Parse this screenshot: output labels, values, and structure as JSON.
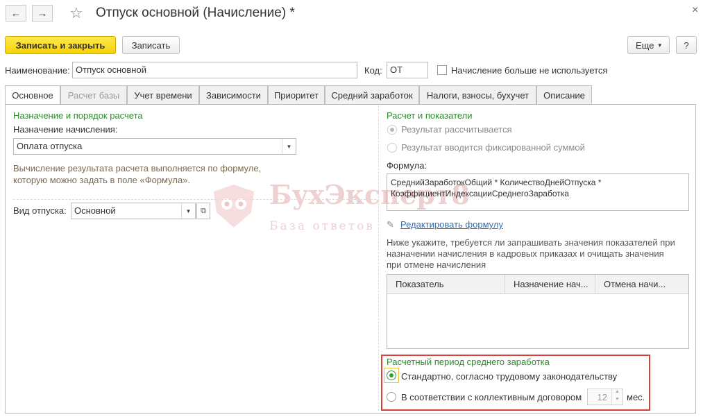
{
  "window": {
    "title": "Отпуск основной (Начисление) *",
    "back_icon": "←",
    "forward_icon": "→",
    "star_icon": "☆",
    "close_icon": "×"
  },
  "toolbar": {
    "save_close_label": "Записать и закрыть",
    "save_label": "Записать",
    "more_label": "Еще",
    "more_arrow": "▾",
    "help_label": "?"
  },
  "header": {
    "name_label": "Наименование:",
    "name_value": "Отпуск основной",
    "code_label": "Код:",
    "code_value": "ОТ",
    "unused_label": "Начисление больше не используется"
  },
  "tabs": [
    {
      "label": "Основное"
    },
    {
      "label": "Расчет базы"
    },
    {
      "label": "Учет времени"
    },
    {
      "label": "Зависимости"
    },
    {
      "label": "Приоритет"
    },
    {
      "label": "Средний заработок"
    },
    {
      "label": "Налоги, взносы, бухучет"
    },
    {
      "label": "Описание"
    }
  ],
  "left": {
    "section_title": "Назначение и порядок расчета",
    "purpose_label": "Назначение начисления:",
    "purpose_value": "Оплата отпуска",
    "hint": "Вычисление результата расчета выполняется по формуле, которую можно задать в поле «Формула».",
    "vacation_label": "Вид отпуска:",
    "vacation_value": "Основной"
  },
  "right": {
    "section_title": "Расчет и показатели",
    "radio_calc": "Результат рассчитывается",
    "radio_fixed": "Результат вводится фиксированной суммой",
    "formula_label": "Формула:",
    "formula_value": "СреднийЗаработокОбщий * КоличествоДнейОтпуска * КоэффициентИндексацииСреднегоЗаработка",
    "edit_formula_link": "Редактировать формулу",
    "indicators_hint": "Ниже укажите, требуется ли запрашивать значения показателей при назначении начисления в кадровых приказах и очищать значения при отмене начисления",
    "grid_headers": [
      "Показатель",
      "Назначение нач...",
      "Отмена начи..."
    ]
  },
  "avg_period": {
    "title": "Расчетный период среднего заработка",
    "option_standard": "Стандартно, согласно трудовому законодательству",
    "option_collective": "В соответствии с коллективным договором",
    "months_value": "12",
    "months_unit": "мес."
  },
  "watermark": {
    "brand": "БухЭксперт8",
    "tagline": "База ответов"
  },
  "colors": {
    "accent_yellow": "#f5d20a",
    "section_green": "#2e8b2e",
    "highlight_red": "#d9403a",
    "link_blue": "#2f6fb5"
  }
}
